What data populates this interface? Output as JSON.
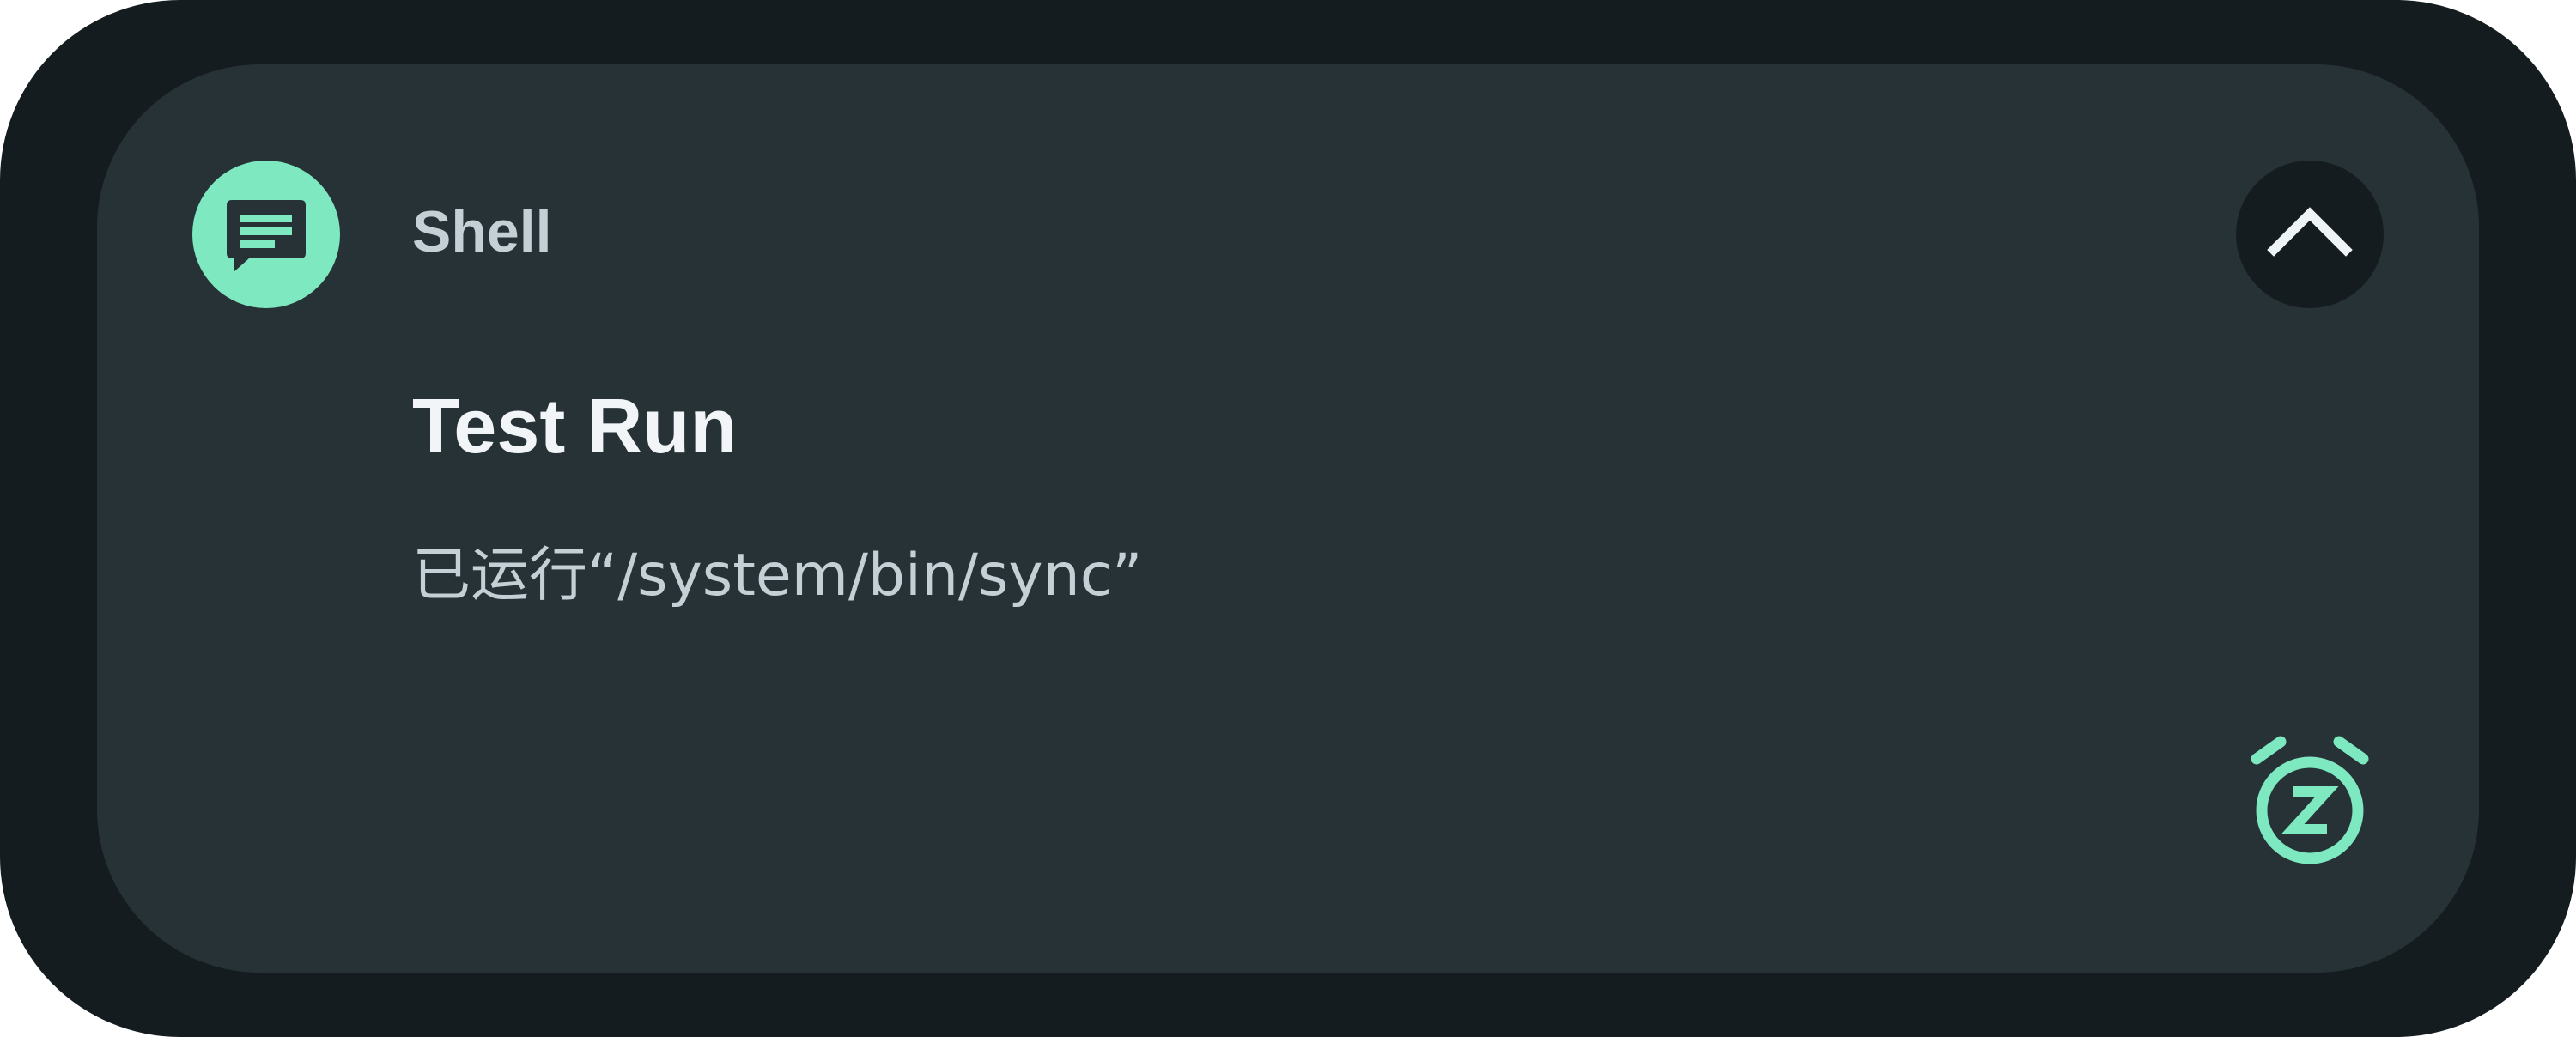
{
  "notification": {
    "app_name": "Shell",
    "title": "Test Run",
    "body": "已运行“/system/bin/sync”",
    "icons": {
      "app": "message-icon",
      "expand": "chevron-up-icon",
      "snooze": "snooze-alarm-icon"
    },
    "colors": {
      "accent": "#7ee8c0",
      "card_background": "#273237",
      "outer_background": "#141c20",
      "title": "#f1f5f7",
      "secondary_text": "#c4d0d6"
    }
  }
}
